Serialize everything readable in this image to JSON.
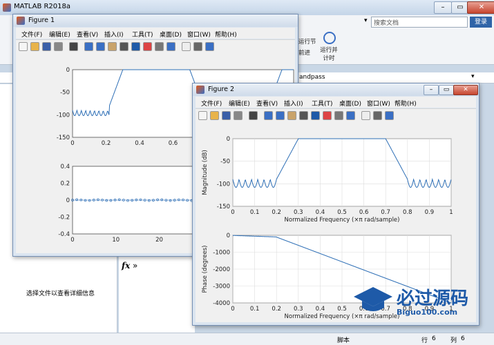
{
  "main": {
    "title": "MATLAB R2018a",
    "search_placeholder": "搜索文档",
    "login": "登录",
    "ribbon": {
      "run_section": "运行节",
      "advance": "前进",
      "run_time_1": "运行并",
      "run_time_2": "计时"
    },
    "path_fragment": "andpass",
    "side_text": "选择文件以查看详细信息",
    "fx": "fx",
    "prompt": "»",
    "status": {
      "script": "脚本",
      "row_label": "行",
      "row": "6",
      "col_label": "列",
      "col": "6"
    }
  },
  "fig1": {
    "title": "Figure 1",
    "menus": [
      "文件(F)",
      "编辑(E)",
      "查看(V)",
      "插入(I)",
      "工具(T)",
      "桌面(D)",
      "窗口(W)",
      "帮助(H)"
    ]
  },
  "fig2": {
    "title": "Figure 2",
    "menus": [
      "文件(F)",
      "编辑(E)",
      "查看(V)",
      "插入(I)",
      "工具(T)",
      "桌面(D)",
      "窗口(W)",
      "帮助(H)"
    ],
    "mag": {
      "ylabel": "Magnitude (dB)",
      "xlabel": "Normalized Frequency  (×π rad/sample)"
    },
    "phase": {
      "ylabel": "Phase (degrees)",
      "xlabel": "Normalized Frequency  (×π rad/sample)"
    }
  },
  "watermark": {
    "text": "必过源码",
    "sub": "Biguo100.com"
  },
  "chart_data": [
    {
      "type": "line",
      "panel": "fig1-top",
      "x": [
        0,
        0.1,
        0.2,
        0.25,
        0.3,
        0.35,
        0.65,
        0.7,
        0.75,
        0.8,
        0.9,
        1.0,
        1.1,
        1.2,
        1.25,
        1.3
      ],
      "values": [
        -100,
        -95,
        -90,
        -55,
        -5,
        0,
        0,
        -5,
        -55,
        -95,
        -90,
        -95,
        -90,
        -55,
        -5,
        0
      ],
      "xticks": [
        "0",
        "0.2",
        "0.4",
        "0.6",
        "0.8",
        "1",
        "1.2"
      ],
      "yticks": [
        "0",
        "-50",
        "-100",
        "-150"
      ],
      "ylim": [
        -150,
        0
      ]
    },
    {
      "type": "scatter",
      "panel": "fig1-bottom",
      "note_series": "stem",
      "x": [
        37,
        38,
        39,
        40,
        41,
        42,
        43,
        44
      ],
      "values": [
        0.03,
        0.05,
        -0.12,
        -0.25,
        0.33,
        0.33,
        -0.25,
        0.05
      ],
      "xticks": [
        "0",
        "10",
        "20",
        "30",
        "40",
        "50"
      ],
      "yticks": [
        "0.4",
        "0.2",
        "0",
        "-0.2",
        "-0.4"
      ],
      "ylim": [
        -0.4,
        0.4
      ]
    },
    {
      "type": "line",
      "panel": "fig2-magnitude",
      "x": [
        0,
        0.1,
        0.18,
        0.2,
        0.25,
        0.3,
        0.7,
        0.75,
        0.8,
        0.82,
        0.9,
        1
      ],
      "values": [
        -110,
        -100,
        -95,
        -80,
        -40,
        0,
        0,
        -40,
        -85,
        -95,
        -100,
        -110
      ],
      "xticks": [
        "0",
        "0.1",
        "0.2",
        "0.3",
        "0.4",
        "0.5",
        "0.6",
        "0.7",
        "0.8",
        "0.9",
        "1"
      ],
      "yticks": [
        "0",
        "-50",
        "-100",
        "-150"
      ],
      "ylim": [
        -150,
        0
      ],
      "xlabel": "Normalized Frequency  (×π rad/sample)",
      "ylabel": "Magnitude (dB)"
    },
    {
      "type": "line",
      "panel": "fig2-phase",
      "x": [
        0,
        0.2,
        1
      ],
      "values": [
        0,
        -100,
        -4400
      ],
      "xticks": [
        "0",
        "0.1",
        "0.2",
        "0.3",
        "0.4",
        "0.5",
        "0.6",
        "0.7",
        "0.8",
        "0.9",
        "1"
      ],
      "yticks": [
        "0",
        "-1000",
        "-2000",
        "-3000",
        "-4000"
      ],
      "ylim": [
        -4400,
        0
      ],
      "xlabel": "Normalized Frequency  (×π rad/sample)",
      "ylabel": "Phase (degrees)"
    }
  ]
}
